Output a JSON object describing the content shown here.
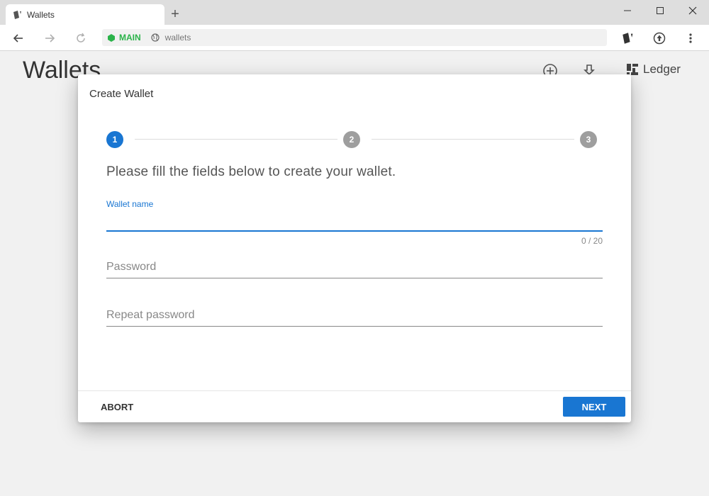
{
  "browser": {
    "tab_title": "Wallets",
    "network_label": "MAIN",
    "url": "wallets"
  },
  "page": {
    "title": "Wallets",
    "ledger_label": "Ledger"
  },
  "dialog": {
    "title": "Create Wallet",
    "steps": [
      "1",
      "2",
      "3"
    ],
    "active_step": 1,
    "instructions": "Please fill the fields below to create your wallet.",
    "wallet_name": {
      "label": "Wallet name",
      "value": "",
      "counter": "0 / 20"
    },
    "password": {
      "placeholder": "Password",
      "value": ""
    },
    "repeat_password": {
      "placeholder": "Repeat password",
      "value": ""
    },
    "abort_label": "ABORT",
    "next_label": "NEXT"
  },
  "colors": {
    "primary": "#1976d2",
    "inactive_step": "#9e9e9e",
    "network_green": "#2bb34a"
  }
}
